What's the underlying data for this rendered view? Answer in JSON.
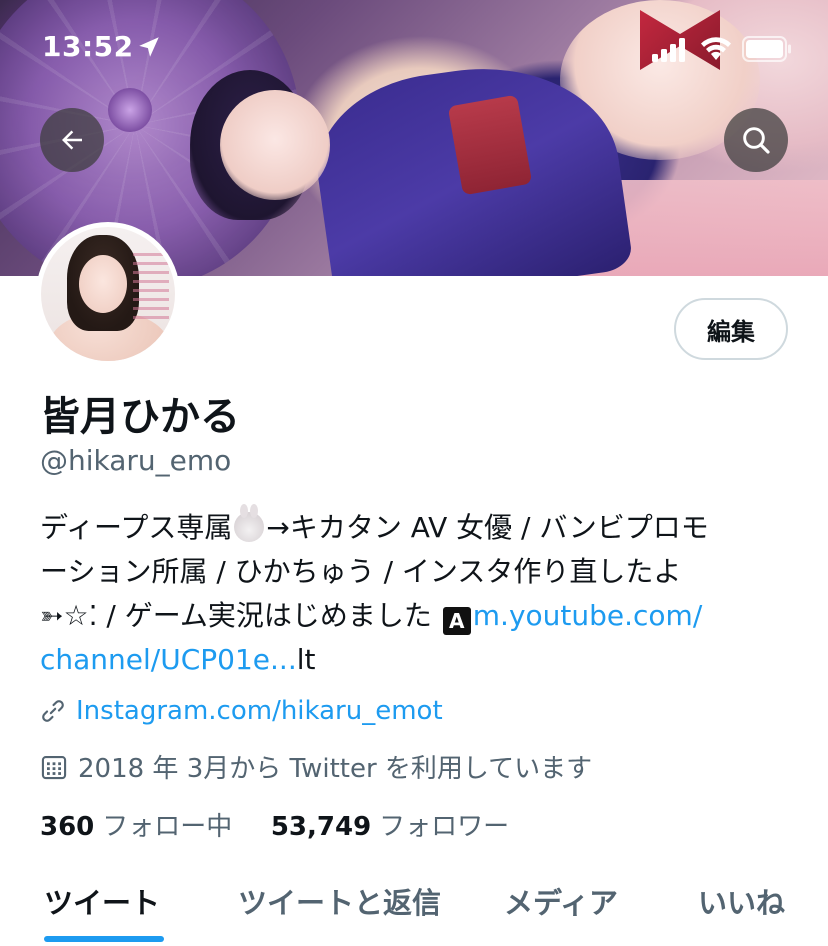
{
  "status_bar": {
    "time": "13:52"
  },
  "header": {
    "back_icon": "arrow-left-icon",
    "search_icon": "search-icon"
  },
  "profile": {
    "edit_label": "編集",
    "display_name": "皆月ひかる",
    "handle": "@hikaru_emo",
    "bio": {
      "line1_a": "ディープス専属",
      "line1_b": "→キカタン AV 女優 / バンビプロモ",
      "line2": "ーション所属 / ひかちゅう / インスタ作り直したよ",
      "line3_a": "➳☆⁚ / ゲーム実況はじめました",
      "emoji_letter": "A",
      "link_a": "m.youtube.com/",
      "link_b": "channel/UCP01e...",
      "tail": "lt"
    },
    "url": "Instagram.com/hikaru_emot",
    "joined": "2018 年 3月から Twitter を利用しています",
    "following_count": "360",
    "following_label": "フォロー中",
    "followers_count": "53,749",
    "followers_label": "フォロワー"
  },
  "tabs": [
    {
      "label": "ツイート",
      "active": true
    },
    {
      "label": "ツイートと返信",
      "active": false
    },
    {
      "label": "メディア",
      "active": false
    },
    {
      "label": "いいね",
      "active": false
    }
  ],
  "colors": {
    "accent": "#1d9bf0",
    "secondary_text": "#536471",
    "primary_text": "#0f1419"
  }
}
